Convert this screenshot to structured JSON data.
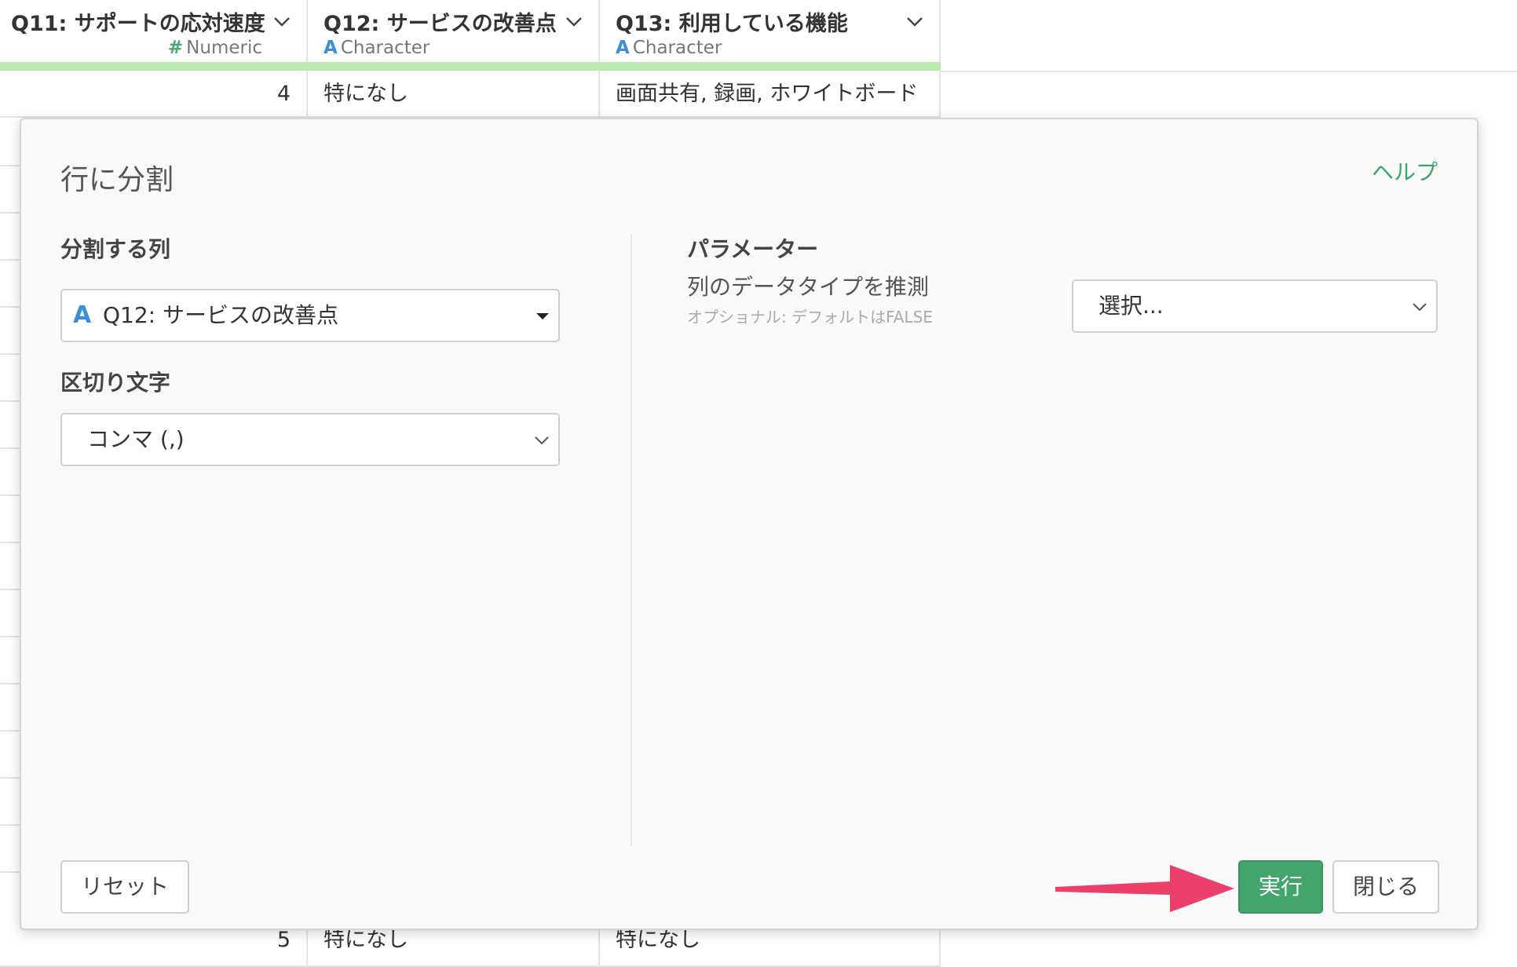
{
  "grid": {
    "columns": [
      {
        "name": "Q11: サポートの応対速度",
        "type_glyph": "#",
        "type_label": "Numeric"
      },
      {
        "name": "Q12: サービスの改善点",
        "type_glyph": "A",
        "type_label": "Character"
      },
      {
        "name": "Q13: 利用している機能",
        "type_glyph": "A",
        "type_label": "Character"
      }
    ],
    "rows": [
      [
        "4",
        "特になし",
        "画面共有, 録画, ホワイトボード"
      ],
      [
        "5",
        "特になし",
        "特になし"
      ]
    ]
  },
  "dialog": {
    "title": "行に分割",
    "help_label": "ヘルプ",
    "split_column": {
      "label": "分割する列",
      "type_glyph": "A",
      "value": "Q12: サービスの改善点"
    },
    "delimiter": {
      "label": "区切り文字",
      "value": "コンマ (,)"
    },
    "parameters": {
      "heading": "パラメーター",
      "guess_type_label": "列のデータタイプを推測",
      "guess_type_hint": "オプショナル: デフォルトはFALSE",
      "guess_type_value": "選択..."
    },
    "buttons": {
      "reset": "リセット",
      "run": "実行",
      "close": "閉じる"
    }
  },
  "colors": {
    "accent_green": "#43a56c",
    "help_green": "#3fa46a",
    "header_bar": "#b9ecaa",
    "character_blue": "#3a8fd9",
    "numeric_green": "#4aa66b",
    "annotation_arrow": "#ec3f6a"
  },
  "icons": {
    "column_menu": "chevron-down-icon",
    "annotation": "arrow-right-icon"
  }
}
